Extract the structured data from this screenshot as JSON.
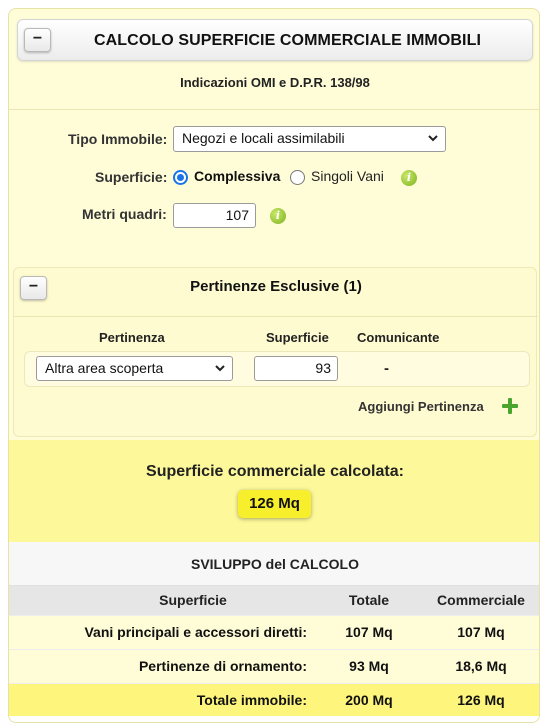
{
  "header": {
    "title": "CALCOLO SUPERFICIE COMMERCIALE IMMOBILI",
    "collapse_label": "−"
  },
  "subtitle": "Indicazioni OMI e D.P.R. 138/98",
  "form": {
    "tipo_label": "Tipo Immobile:",
    "tipo_value": "Negozi e locali assimilabili",
    "superficie_label": "Superficie:",
    "radio_complessiva": "Complessiva",
    "radio_singoli": "Singoli Vani",
    "radio_selected": "Complessiva",
    "metri_label": "Metri quadri:",
    "metri_value": "107"
  },
  "pertinenze": {
    "collapse_label": "−",
    "title": "Pertinenze Esclusive (1)",
    "col_pertinenza": "Pertinenza",
    "col_superficie": "Superficie",
    "col_comunicante": "Comunicante",
    "rows": [
      {
        "tipo": "Altra area scoperta",
        "superficie": "93",
        "comunicante": "-"
      }
    ],
    "add_label": "Aggiungi Pertinenza"
  },
  "result": {
    "label": "Superficie commerciale calcolata:",
    "value": "126 Mq"
  },
  "calc": {
    "title": "SVILUPPO del CALCOLO",
    "headers": [
      "Superficie",
      "Totale",
      "Commerciale"
    ],
    "rows": [
      [
        "Vani principali e accessori diretti:",
        "107 Mq",
        "107 Mq"
      ],
      [
        "Pertinenze di ornamento:",
        "93 Mq",
        "18,6 Mq"
      ]
    ],
    "total": [
      "Totale immobile:",
      "200 Mq",
      "126 Mq"
    ]
  },
  "colors": {
    "panel_bg": "#fffdd8",
    "result_bg": "#fdf99a",
    "badge_bg": "#f7ee2c",
    "radio_accent": "#1a73e8",
    "info_green": "#7fb21d",
    "plus_green": "#4aa52e"
  },
  "icons": {
    "info": "info-icon",
    "plus": "plus-icon",
    "chevron": "chevron-down-icon"
  }
}
